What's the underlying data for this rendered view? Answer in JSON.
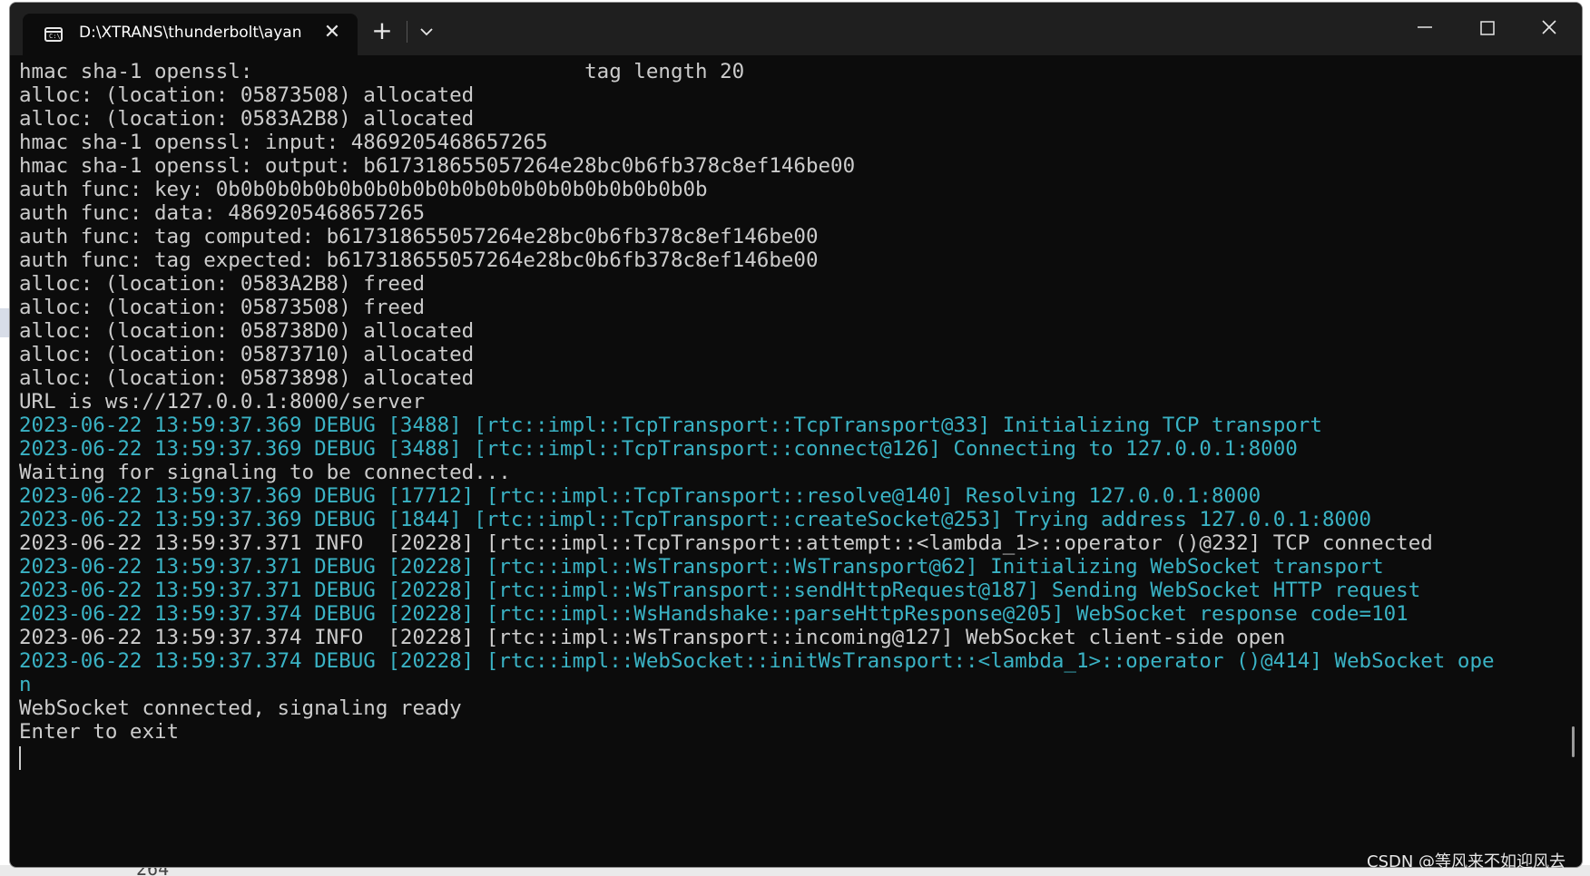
{
  "window": {
    "tab_title": "D:\\XTRANS\\thunderbolt\\ayan",
    "tab_icon": "terminal-icon",
    "tab_icon_glyph": "C:\\",
    "new_tab_label": "+",
    "close_tab_label": "✕"
  },
  "console_lines": [
    {
      "text": "hmac sha-1 openssl:                           tag length 20",
      "level": "plain"
    },
    {
      "text": "alloc: (location: 05873508) allocated",
      "level": "plain"
    },
    {
      "text": "alloc: (location: 0583A2B8) allocated",
      "level": "plain"
    },
    {
      "text": "hmac sha-1 openssl: input: 4869205468657265",
      "level": "plain"
    },
    {
      "text": "hmac sha-1 openssl: output: b617318655057264e28bc0b6fb378c8ef146be00",
      "level": "plain"
    },
    {
      "text": "auth func: key: 0b0b0b0b0b0b0b0b0b0b0b0b0b0b0b0b0b0b0b0b",
      "level": "plain"
    },
    {
      "text": "auth func: data: 4869205468657265",
      "level": "plain"
    },
    {
      "text": "auth func: tag computed: b617318655057264e28bc0b6fb378c8ef146be00",
      "level": "plain"
    },
    {
      "text": "auth func: tag expected: b617318655057264e28bc0b6fb378c8ef146be00",
      "level": "plain"
    },
    {
      "text": "alloc: (location: 0583A2B8) freed",
      "level": "plain"
    },
    {
      "text": "alloc: (location: 05873508) freed",
      "level": "plain"
    },
    {
      "text": "alloc: (location: 058738D0) allocated",
      "level": "plain"
    },
    {
      "text": "alloc: (location: 05873710) allocated",
      "level": "plain"
    },
    {
      "text": "alloc: (location: 05873898) allocated",
      "level": "plain"
    },
    {
      "text": "URL is ws://127.0.0.1:8000/server",
      "level": "plain"
    },
    {
      "text": "2023-06-22 13:59:37.369 DEBUG [3488] [rtc::impl::TcpTransport::TcpTransport@33] Initializing TCP transport",
      "level": "debug"
    },
    {
      "text": "2023-06-22 13:59:37.369 DEBUG [3488] [rtc::impl::TcpTransport::connect@126] Connecting to 127.0.0.1:8000",
      "level": "debug"
    },
    {
      "text": "Waiting for signaling to be connected...",
      "level": "plain"
    },
    {
      "text": "2023-06-22 13:59:37.369 DEBUG [17712] [rtc::impl::TcpTransport::resolve@140] Resolving 127.0.0.1:8000",
      "level": "debug"
    },
    {
      "text": "2023-06-22 13:59:37.369 DEBUG [1844] [rtc::impl::TcpTransport::createSocket@253] Trying address 127.0.0.1:8000",
      "level": "debug"
    },
    {
      "text": "2023-06-22 13:59:37.371 INFO  [20228] [rtc::impl::TcpTransport::attempt::<lambda_1>::operator ()@232] TCP connected",
      "level": "plain"
    },
    {
      "text": "2023-06-22 13:59:37.371 DEBUG [20228] [rtc::impl::WsTransport::WsTransport@62] Initializing WebSocket transport",
      "level": "debug"
    },
    {
      "text": "2023-06-22 13:59:37.371 DEBUG [20228] [rtc::impl::WsTransport::sendHttpRequest@187] Sending WebSocket HTTP request",
      "level": "debug"
    },
    {
      "text": "2023-06-22 13:59:37.374 DEBUG [20228] [rtc::impl::WsHandshake::parseHttpResponse@205] WebSocket response code=101",
      "level": "debug"
    },
    {
      "text": "2023-06-22 13:59:37.374 INFO  [20228] [rtc::impl::WsTransport::incoming@127] WebSocket client-side open",
      "level": "plain"
    },
    {
      "text": "2023-06-22 13:59:37.374 DEBUG [20228] [rtc::impl::WebSocket::initWsTransport::<lambda_1>::operator ()@414] WebSocket ope",
      "level": "debug"
    },
    {
      "text": "n",
      "level": "debug"
    },
    {
      "text": "WebSocket connected, signaling ready",
      "level": "plain"
    },
    {
      "text": "Enter to exit",
      "level": "plain"
    }
  ],
  "colors": {
    "terminal_bg": "#0c0c0c",
    "plain_text": "#cccccc",
    "debug_text": "#3ab3c5",
    "titlebar_bg": "#1f1f1f"
  },
  "background": {
    "bottom_text": "264"
  },
  "watermark": "CSDN @等风来不如迎风去"
}
